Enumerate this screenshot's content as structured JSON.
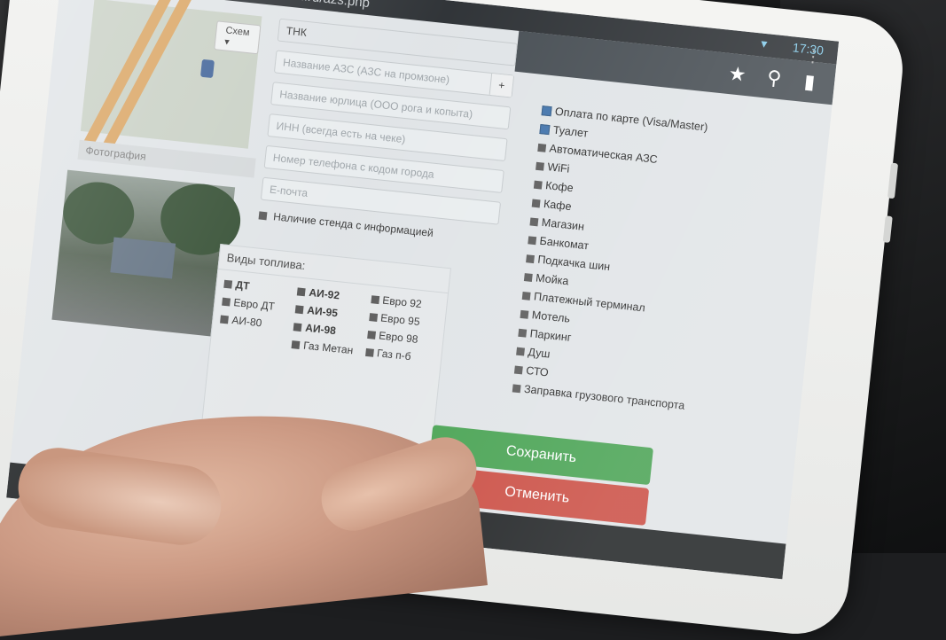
{
  "statusbar": {
    "url": "eroiled.ru/azs.php",
    "time": "17:30"
  },
  "map": {
    "scheme_label": "Схем"
  },
  "photo": {
    "label": "Фотография"
  },
  "form": {
    "brand_value": "ТНК",
    "name_placeholder": "Название АЗС (АЗС на промзоне)",
    "plus": "+",
    "legal_placeholder": "Название юрлица (ООО рога и копыта)",
    "inn_placeholder": "ИНН (всегда есть на чеке)",
    "phone_placeholder": "Номер телефона с кодом города",
    "email_placeholder": "E-почта",
    "stand_label": "Наличие стенда с информацией"
  },
  "fuel": {
    "title": "Виды топлива:",
    "items": [
      {
        "label": "ДТ",
        "bold": true
      },
      {
        "label": "АИ-92",
        "bold": true
      },
      {
        "label": "Евро 92",
        "bold": false
      },
      {
        "label": "Евро ДТ",
        "bold": false
      },
      {
        "label": "АИ-95",
        "bold": true
      },
      {
        "label": "Евро 95",
        "bold": false
      },
      {
        "label": "АИ-80",
        "bold": false
      },
      {
        "label": "АИ-98",
        "bold": true
      },
      {
        "label": "Евро 98",
        "bold": false
      },
      {
        "label": "",
        "bold": false
      },
      {
        "label": "Газ Метан",
        "bold": false
      },
      {
        "label": "Газ п-б",
        "bold": false
      }
    ]
  },
  "services": [
    {
      "label": "Оплата по карте (Visa/Master)",
      "checked": true
    },
    {
      "label": "Туалет",
      "checked": true
    },
    {
      "label": "Автоматическая АЗС",
      "checked": false
    },
    {
      "label": "WiFi",
      "checked": false
    },
    {
      "label": "Кофе",
      "checked": false
    },
    {
      "label": "Кафе",
      "checked": false
    },
    {
      "label": "Магазин",
      "checked": false
    },
    {
      "label": "Банкомат",
      "checked": false
    },
    {
      "label": "Подкачка шин",
      "checked": false
    },
    {
      "label": "Мойка",
      "checked": false
    },
    {
      "label": "Платежный терминал",
      "checked": false
    },
    {
      "label": "Мотель",
      "checked": false
    },
    {
      "label": "Паркинг",
      "checked": false
    },
    {
      "label": "Душ",
      "checked": false
    },
    {
      "label": "СТО",
      "checked": false
    },
    {
      "label": "Заправка грузового транспорта",
      "checked": false
    }
  ],
  "buttons": {
    "save": "Сохранить",
    "cancel": "Отменить"
  },
  "colors": {
    "save": "#3f9e4a",
    "cancel": "#c8453a",
    "actionbar": "#40474d"
  },
  "icons": [
    "star-icon",
    "search-icon",
    "bookmark-icon"
  ]
}
